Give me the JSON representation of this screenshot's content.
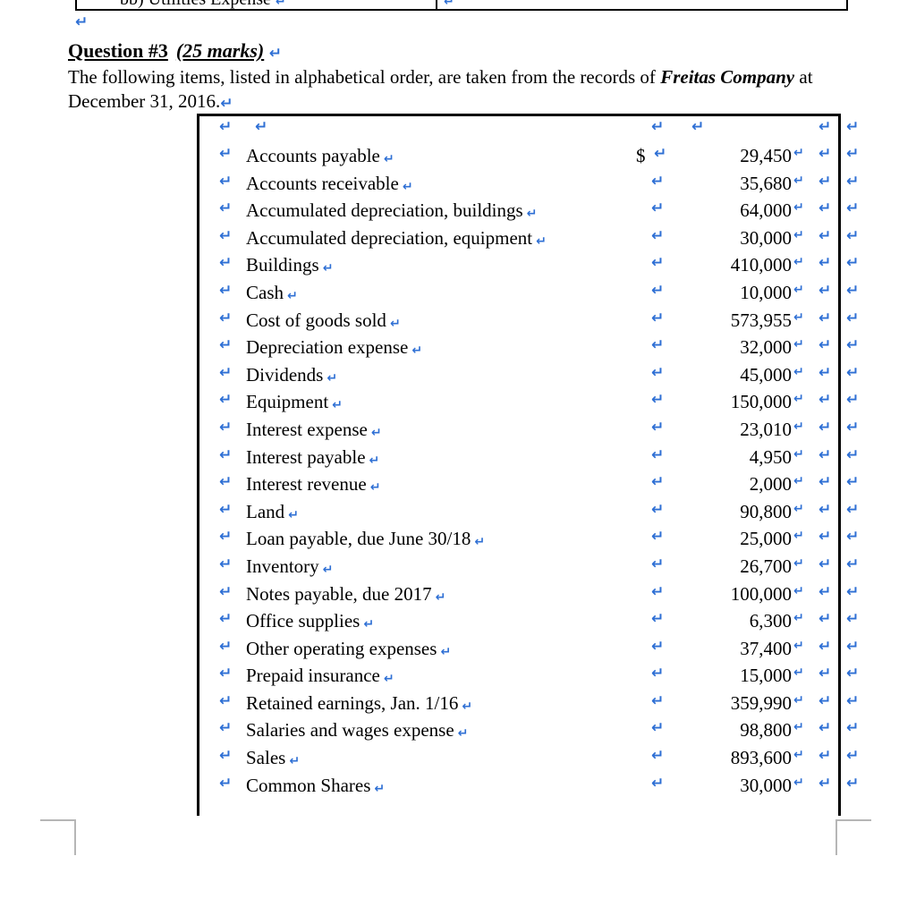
{
  "top_table": {
    "left_cell": "bb) Utilities Expense",
    "left_cell_mark": "↵",
    "right_cell_mark": "↵",
    "outside_mark": "↵"
  },
  "lone_paragraph_mark": "↵",
  "heading": {
    "question": "Question #3",
    "marks": "(25 marks)",
    "paragraph_mark": "↵"
  },
  "intro": {
    "part1": "The following items, listed in alphabetical order, are taken from the records of ",
    "company": "Freitas Company",
    "part2": " at December 31, 2016.",
    "paragraph_mark": "↵"
  },
  "marks": {
    "return": "↵"
  },
  "table": {
    "currency_symbol": "$",
    "rows": [
      {
        "label": "Accounts payable",
        "value": "29,450",
        "dollar": true
      },
      {
        "label": "Accounts receivable",
        "value": "35,680",
        "dollar": false
      },
      {
        "label": "Accumulated depreciation, buildings",
        "value": "64,000",
        "dollar": false
      },
      {
        "label": "Accumulated depreciation, equipment",
        "value": "30,000",
        "dollar": false
      },
      {
        "label": "Buildings",
        "value": "410,000",
        "dollar": false
      },
      {
        "label": "Cash",
        "value": "10,000",
        "dollar": false
      },
      {
        "label": "Cost of goods sold",
        "value": "573,955",
        "dollar": false
      },
      {
        "label": "Depreciation expense",
        "value": "32,000",
        "dollar": false
      },
      {
        "label": "Dividends",
        "value": "45,000",
        "dollar": false
      },
      {
        "label": "Equipment",
        "value": "150,000",
        "dollar": false
      },
      {
        "label": "Interest expense",
        "value": "23,010",
        "dollar": false
      },
      {
        "label": "Interest payable",
        "value": "4,950",
        "dollar": false
      },
      {
        "label": "Interest revenue",
        "value": "2,000",
        "dollar": false
      },
      {
        "label": "Land",
        "value": "90,800",
        "dollar": false
      },
      {
        "label": "Loan payable, due June 30/18",
        "value": "25,000",
        "dollar": false
      },
      {
        "label": "Inventory",
        "value": "26,700",
        "dollar": false
      },
      {
        "label": "Notes payable, due 2017",
        "value": "100,000",
        "dollar": false
      },
      {
        "label": "Office supplies",
        "value": "6,300",
        "dollar": false
      },
      {
        "label": "Other operating expenses",
        "value": "37,400",
        "dollar": false
      },
      {
        "label": "Prepaid insurance",
        "value": "15,000",
        "dollar": false
      },
      {
        "label": "Retained earnings, Jan. 1/16",
        "value": "359,990",
        "dollar": false
      },
      {
        "label": "Salaries and wages expense",
        "value": "98,800",
        "dollar": false
      },
      {
        "label": "Sales",
        "value": "893,600",
        "dollar": false
      },
      {
        "label": "Common Shares",
        "value": "30,000",
        "dollar": false
      }
    ]
  },
  "colors": {
    "formatting_mark": "#2e6fd4",
    "grammar_squiggle": "#2bbd2b",
    "crop_mark": "#b6b6b6",
    "text": "#000000"
  }
}
